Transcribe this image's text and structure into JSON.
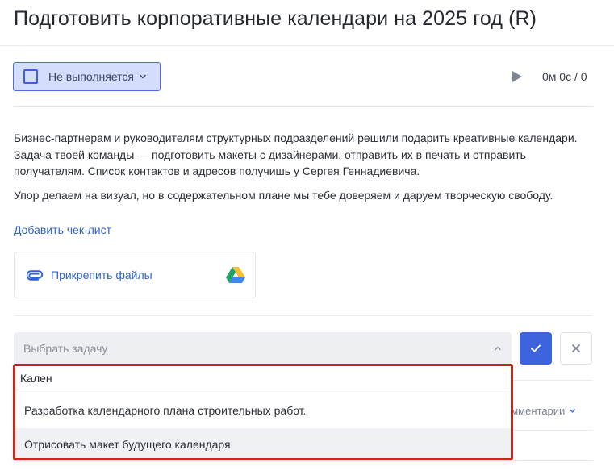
{
  "header": {
    "title": "Подготовить корпоративные календари на 2025 год (R)"
  },
  "status": {
    "label": "Не выполняется",
    "accent_color": "#3f5fd8",
    "background_color": "#d4ddfb"
  },
  "timer": {
    "text": "0м 0с / 0"
  },
  "description": {
    "paragraph_1": "Бизнес-партнерам и руководителям структурных подразделений решили подарить креативные календари. Задача твоей команды — подготовить макеты с дизайнерами, отправить их в печать и отправить получателям. Список контактов и адресов получишь у Сергея Геннадиевича.",
    "paragraph_2": "Упор делаем на визуал, но в содержательном плане мы тебе доверяем и даруем творческую свободу."
  },
  "checklist": {
    "add_label": "Добавить чек-лист"
  },
  "attachments": {
    "label": "Прикрепить файлы"
  },
  "task_select": {
    "placeholder": "Выбрать задачу",
    "search_value": "Кален",
    "options": [
      "Разработка календарного плана строительных работ.",
      "Отрисовать макет будущего календаря"
    ]
  },
  "comments": {
    "label": "омментарии"
  },
  "colors": {
    "primary": "#3d63dd",
    "link": "#2f63d6",
    "highlight_border": "#c22a1e"
  }
}
